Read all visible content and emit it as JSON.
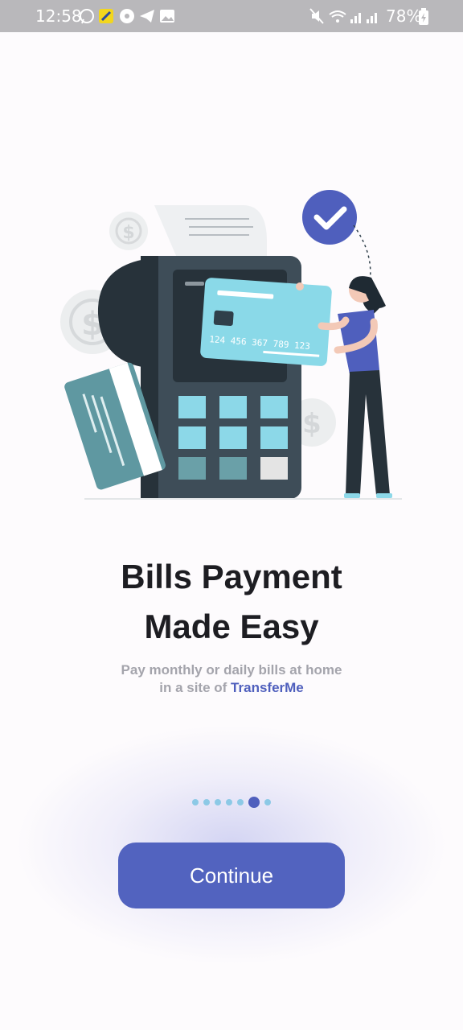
{
  "status_bar": {
    "time": "12:58",
    "battery": "78%",
    "icons_left": [
      "whatsapp-icon",
      "app-icon",
      "chrome-icon",
      "telegram-icon",
      "gallery-icon"
    ],
    "icons_right": [
      "mute-icon",
      "wifi-icon",
      "signal-icon",
      "signal-icon",
      "battery-charging-icon"
    ]
  },
  "illustration": {
    "card_number": "124 456 367 789 123"
  },
  "onboarding": {
    "title_line1": "Bills Payment",
    "title_line2": "Made Easy",
    "subtitle_line1": "Pay monthly or daily bills at home",
    "subtitle_prefix": "in a site of ",
    "brand_name": "TransferMe"
  },
  "pagination": {
    "total": 7,
    "active_index": 5
  },
  "actions": {
    "continue_label": "Continue"
  },
  "colors": {
    "accent": "#5263bf",
    "dot_inactive": "#8cc9e6",
    "card_blue": "#8cd8e8",
    "terminal": "#3a4a55"
  }
}
